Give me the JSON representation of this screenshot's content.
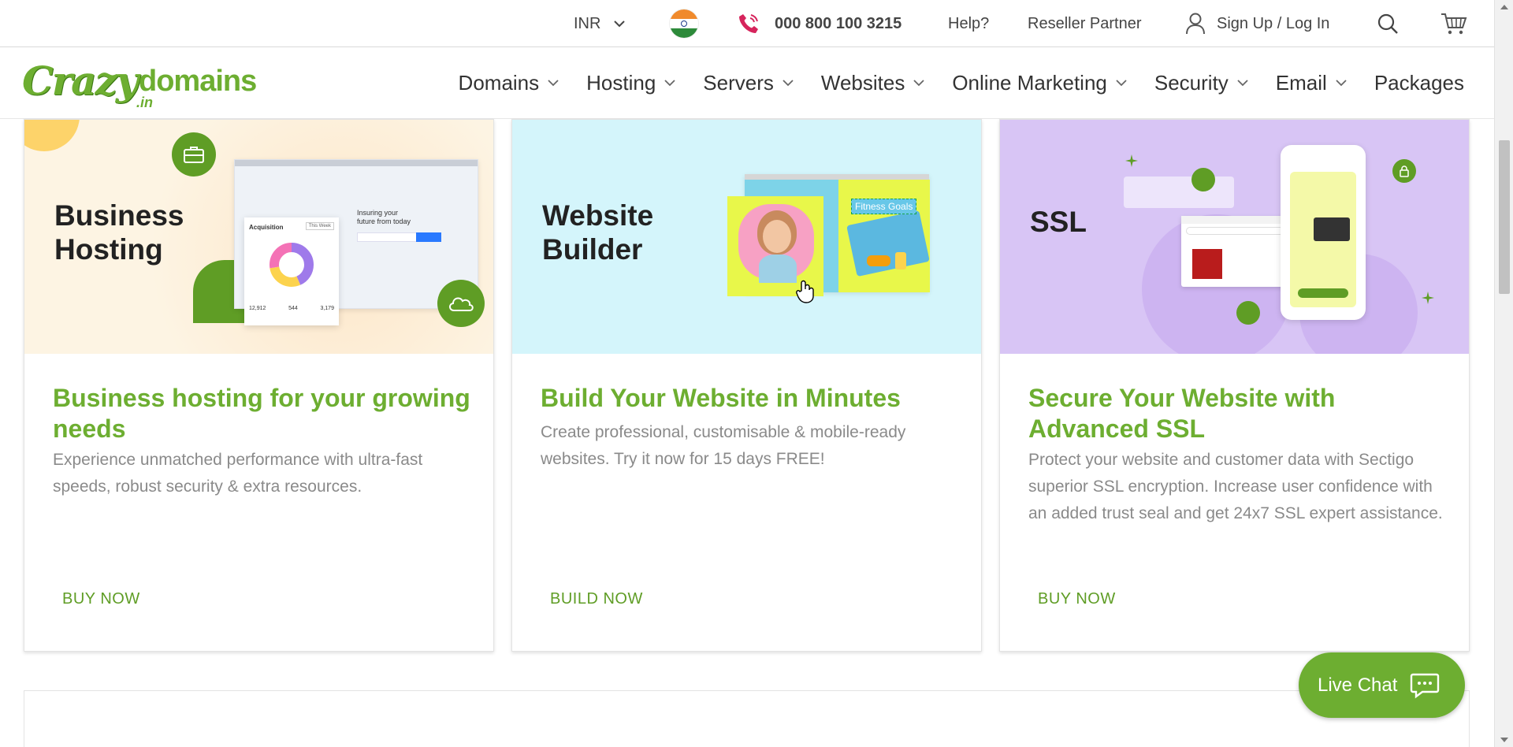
{
  "topbar": {
    "currency": "INR",
    "phone": "000 800 100 3215",
    "help": "Help?",
    "reseller": "Reseller Partner",
    "signup": "Sign Up / Log In"
  },
  "nav": {
    "logo_main": "Crazy",
    "logo_domains": "domains",
    "logo_tld": ".in",
    "items": [
      {
        "label": "Domains"
      },
      {
        "label": "Hosting"
      },
      {
        "label": "Servers"
      },
      {
        "label": "Websites"
      },
      {
        "label": "Online Marketing"
      },
      {
        "label": "Security"
      },
      {
        "label": "Email"
      },
      {
        "label": "Packages"
      }
    ]
  },
  "cards": [
    {
      "banner_title_1": "Business",
      "banner_title_2": "Hosting",
      "heading": "Business hosting for your growing needs",
      "description": "Experience unmatched performance with ultra-fast speeds, robust security & extra resources.",
      "cta": "BUY NOW",
      "mock": {
        "tagline_1": "Insuring your",
        "tagline_2": "future from today",
        "panel_title": "Acquisition",
        "panel_filter": "This Week",
        "stats": [
          "12,912",
          "544",
          "3,179"
        ]
      }
    },
    {
      "banner_title_1": "Website",
      "banner_title_2": "Builder",
      "heading": "Build Your Website in Minutes",
      "description": "Create professional, customisable & mobile-ready websites. Try it now for 15 days FREE!",
      "cta": "BUILD NOW",
      "mock": {
        "tag": "Fitness Goals"
      }
    },
    {
      "banner_title_1": "SSL",
      "heading": "Secure Your Website with Advanced SSL",
      "description": "Protect your website and customer data with Sectigo superior SSL encryption. Increase user confidence with an added trust seal and get 24x7 SSL expert assistance.",
      "cta": "BUY NOW"
    }
  ],
  "livechat": {
    "label": "Live Chat"
  },
  "colors": {
    "brand_green": "#6dae31",
    "card1_bg": "#fdf4e3",
    "card2_bg": "#d4f5fb",
    "card3_bg": "#d8c5f5"
  }
}
